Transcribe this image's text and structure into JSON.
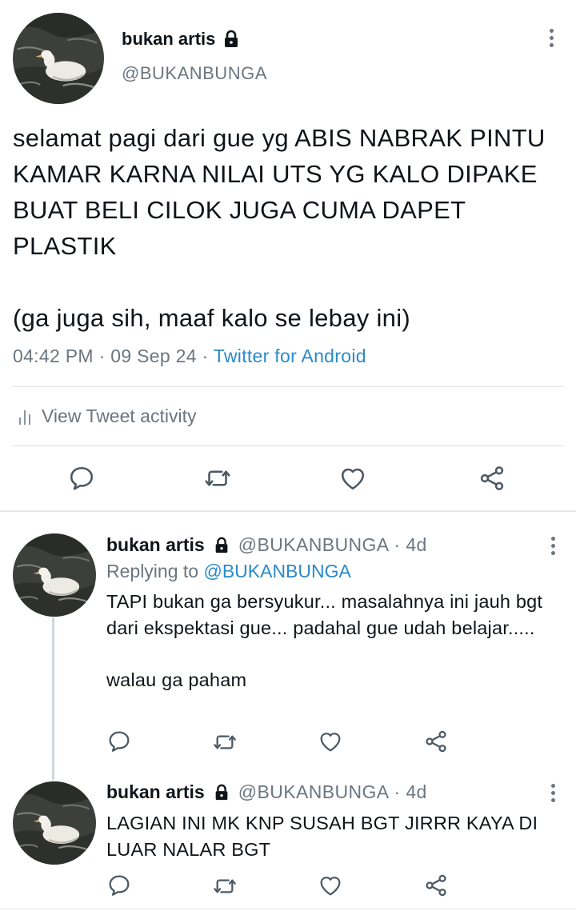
{
  "main_tweet": {
    "display_name": "bukan artis",
    "handle": "@BUKANBUNGA",
    "text": "selamat pagi dari gue yg ABIS NABRAK PINTU KAMAR KARNA NILAI UTS YG KALO DIPAKE BUAT BELI CILOK JUGA CUMA DAPET PLASTIK\n\n(ga juga sih, maaf kalo se lebay ini)",
    "time": "04:42 PM",
    "date": "09 Sep 24",
    "separator": "·",
    "source": "Twitter for Android",
    "activity_label": "View Tweet activity"
  },
  "replies": [
    {
      "display_name": "bukan artis",
      "handle": "@BUKANBUNGA",
      "age": "· 4d",
      "replying_prefix": "Replying to",
      "replying_to": "@BUKANBUNGA",
      "text": "TAPI bukan ga bersyukur... masalahnya ini jauh bgt dari ekspektasi gue... padahal gue udah belajar.....\n\nwalau ga paham"
    },
    {
      "display_name": "bukan artis",
      "handle": "@BUKANBUNGA",
      "age": "· 4d",
      "text": "LAGIAN INI MK KNP SUSAH BGT JIRRR KAYA DI LUAR NALAR BGT"
    }
  ],
  "colors": {
    "text": "#0f1419",
    "secondary": "#6b7680",
    "link": "#2a8ac9",
    "divider": "#dde2e6"
  },
  "icons": [
    "lock-icon",
    "more-icon",
    "reply-icon",
    "retweet-icon",
    "like-icon",
    "share-icon",
    "activity-bars-icon"
  ]
}
